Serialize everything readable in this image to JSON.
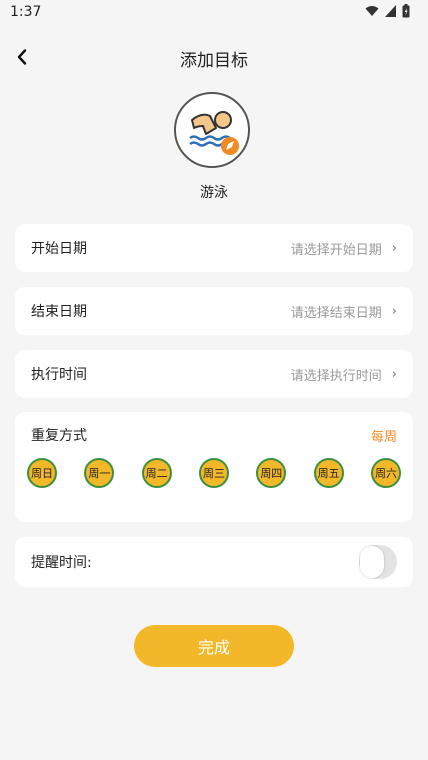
{
  "status_bar": {
    "time": "1:37"
  },
  "nav": {
    "title": "添加目标"
  },
  "activity": {
    "name": "游泳",
    "icon": "swimming-icon"
  },
  "fields": {
    "start_date": {
      "label": "开始日期",
      "placeholder": "请选择开始日期"
    },
    "end_date": {
      "label": "结束日期",
      "placeholder": "请选择结束日期"
    },
    "exec_time": {
      "label": "执行时间",
      "placeholder": "请选择执行时间"
    }
  },
  "repeat": {
    "label": "重复方式",
    "mode": "每周",
    "days": [
      "周日",
      "周一",
      "周二",
      "周三",
      "周四",
      "周五",
      "周六"
    ]
  },
  "reminder": {
    "label": "提醒时间:",
    "enabled": false
  },
  "done_button": {
    "label": "完成"
  },
  "colors": {
    "accent": "#f2b829",
    "mode_text": "#f08a24",
    "day_border": "#3d8f3d"
  }
}
